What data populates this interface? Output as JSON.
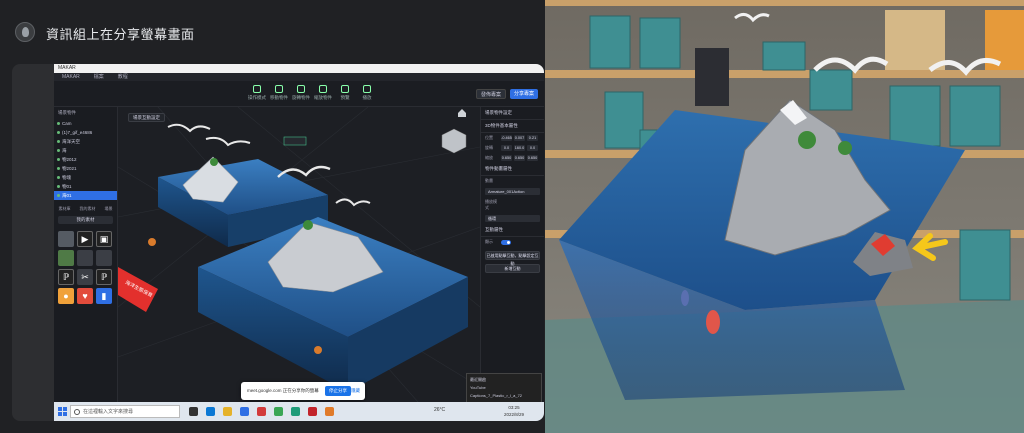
{
  "meet": {
    "presenter_label": "資訊組上在分享螢幕畫面"
  },
  "app": {
    "title": "MAKAR",
    "menu": [
      "MAKAR",
      "檔案",
      "教程"
    ],
    "toolbar": {
      "tools": [
        "操作模式",
        "移動物件",
        "旋轉物件",
        "縮放物件",
        "預覽",
        "播放"
      ],
      "publish_label": "發佈專案",
      "share_label": "分享專案"
    },
    "scene_tree": {
      "title": "場景物件",
      "items": [
        "Cam",
        "(1)7_gif_e4686",
        "海洋天空",
        "海",
        "物2012",
        "物2021",
        "物塊",
        "物01",
        "海01"
      ],
      "selected_index": 8
    },
    "library": {
      "tabs": [
        "素材庫",
        "我的素材",
        "場景"
      ],
      "dropdown": "我的素材"
    },
    "viewport": {
      "button": "場景互動設定",
      "sign": "海洋生態保育"
    },
    "properties": {
      "title": "場景物件設定",
      "transform": {
        "header": "3D物件基本屬性",
        "rows": [
          {
            "label": "位置",
            "values": [
              "-0.465",
              "0.007",
              "0.21"
            ]
          },
          {
            "label": "旋轉",
            "values": [
              "0.0",
              "160.0",
              "0.0"
            ]
          },
          {
            "label": "縮放",
            "values": [
              "0.650",
              "0.650",
              "0.650"
            ]
          }
        ]
      },
      "animation": {
        "header": "物件動畫屬性",
        "rows": [
          {
            "label": "動畫",
            "value": "Armature_001Action"
          },
          {
            "label": "播放模式",
            "value": "循環"
          }
        ]
      },
      "behavior": {
        "header": "互動屬性",
        "toggle_label": "顯示",
        "button": "已啟用點擊互動，點擊設定互動",
        "add_button": "新增互動"
      }
    },
    "meet_popup": {
      "message": "meet.google.com 正在分享你的螢幕",
      "stop_label": "停止分享",
      "hide_label": "隱藏"
    },
    "notifications": {
      "header": "最近開啟",
      "items": [
        "YouTube",
        "Captions_7_Plastic_r_l_a_72"
      ]
    },
    "taskbar": {
      "search_placeholder": "在這裡輸入文字來搜尋",
      "weather": "26°C",
      "time": "03:25",
      "date": "2022/8/29"
    }
  },
  "colors": {
    "accent": "#2f6fe4",
    "water": "#2f72b8",
    "sign": "#e3302d"
  }
}
